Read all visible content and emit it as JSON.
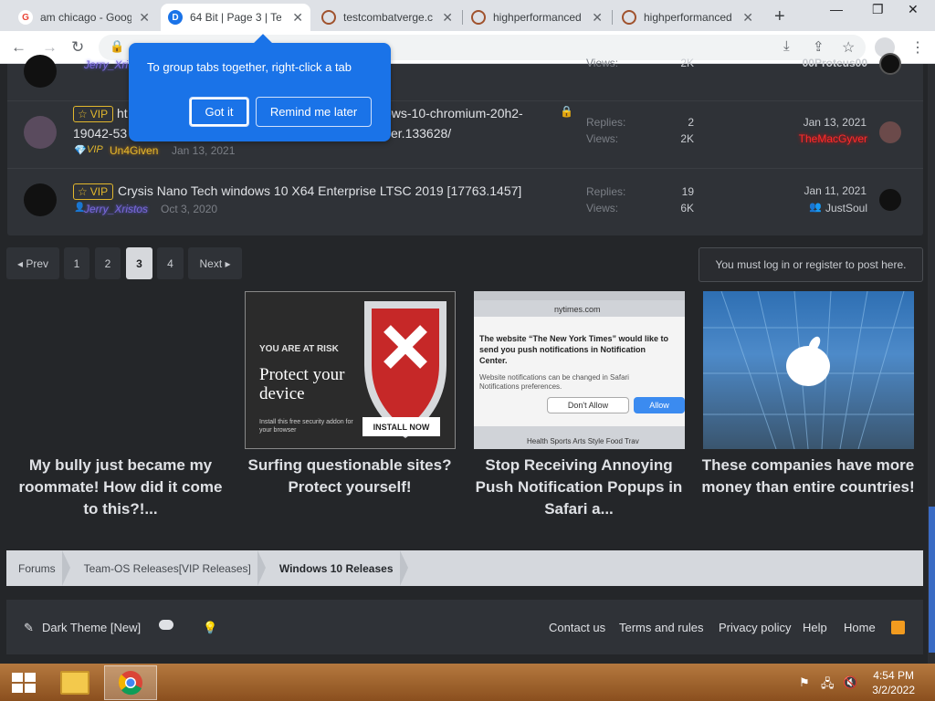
{
  "browser": {
    "tabs": [
      {
        "title": "am chicago - Goog",
        "fav": "G",
        "fav_color": "#ea4335"
      },
      {
        "title": "64 Bit | Page 3 | Te",
        "fav": "D",
        "fav_color": "#1a73e8"
      },
      {
        "title": "testcombatverge.c",
        "fav": "",
        "fav_color": "#a0522d"
      },
      {
        "title": "highperformanced",
        "fav": "",
        "fav_color": "#a0522d"
      },
      {
        "title": "highperformanced",
        "fav": "",
        "fav_color": "#a0522d"
      }
    ],
    "new_tab": "+",
    "tooltip": {
      "text": "To group tabs together, right-click a tab",
      "got_it": "Got it",
      "remind": "Remind me later"
    }
  },
  "threads": [
    {
      "title": "",
      "user": "Jerry_Xri",
      "replies_label": "",
      "views_label": "Views:",
      "replies": "",
      "views": "2K",
      "last_date": "",
      "last_user": "00Proteus00",
      "last_user_color": "#6b63ff"
    },
    {
      "vip": "VIP",
      "title_a": "ht",
      "title_b": "ows-10-chromium-20h2-",
      "title_c": "19042-53",
      "title_d": "ver.133628/",
      "user": "Un4Given",
      "date": "Jan 13, 2021",
      "replies_label": "Replies:",
      "views_label": "Views:",
      "replies": "2",
      "views": "2K",
      "last_date": "Jan 13, 2021",
      "last_user": "TheMacGyver",
      "last_user_color": "#ff2b2b"
    },
    {
      "vip": "VIP",
      "title": "Crysis Nano Tech windows 10 X64 Enterprise LTSC 2019 [17763.1457]",
      "user": "Jerry_Xristos",
      "date": "Oct 3, 2020",
      "replies_label": "Replies:",
      "views_label": "Views:",
      "replies": "19",
      "views": "6K",
      "last_date": "Jan 11, 2021",
      "last_user": "JustSoul",
      "last_user_color": "#c8cbd0"
    }
  ],
  "pagination": {
    "prev": "◂ Prev",
    "pages": [
      "1",
      "2",
      "3",
      "4"
    ],
    "current": "3",
    "next": "Next ▸"
  },
  "login_notice": "You must log in or register to post here.",
  "ads": [
    {
      "caption": "My bully just became my roommate! How did it come to this?!..."
    },
    {
      "caption": "Surfing questionable sites? Protect yourself!",
      "img_risk": "YOU ARE AT RISK",
      "img_head": "Protect your device",
      "img_small": "Install this free security addon for your browser",
      "img_btn": "INSTALL NOW"
    },
    {
      "caption": "Stop Receiving Annoying Push Notification Popups in Safari a...",
      "img_site": "nytimes.com",
      "img_msg": "The website “The New York Times” would like to send you push notifications in Notification Center.",
      "img_sub": "Website notifications can be changed in Safari Notifications preferences.",
      "img_deny": "Don't Allow",
      "img_allow": "Allow",
      "img_menu": "Health   Sports   Arts   Style   Food   Trav"
    },
    {
      "caption": "These companies have more money than entire countries!"
    }
  ],
  "breadcrumbs": [
    "Forums",
    "Team-OS Releases[VIP Releases]",
    "Windows 10 Releases"
  ],
  "footer": {
    "theme": "Dark Theme [New]",
    "links": [
      "Contact us",
      "Terms and rules",
      "Privacy policy",
      "Help",
      "Home"
    ]
  },
  "taskbar": {
    "time": "4:54 PM",
    "date": "3/2/2022"
  }
}
